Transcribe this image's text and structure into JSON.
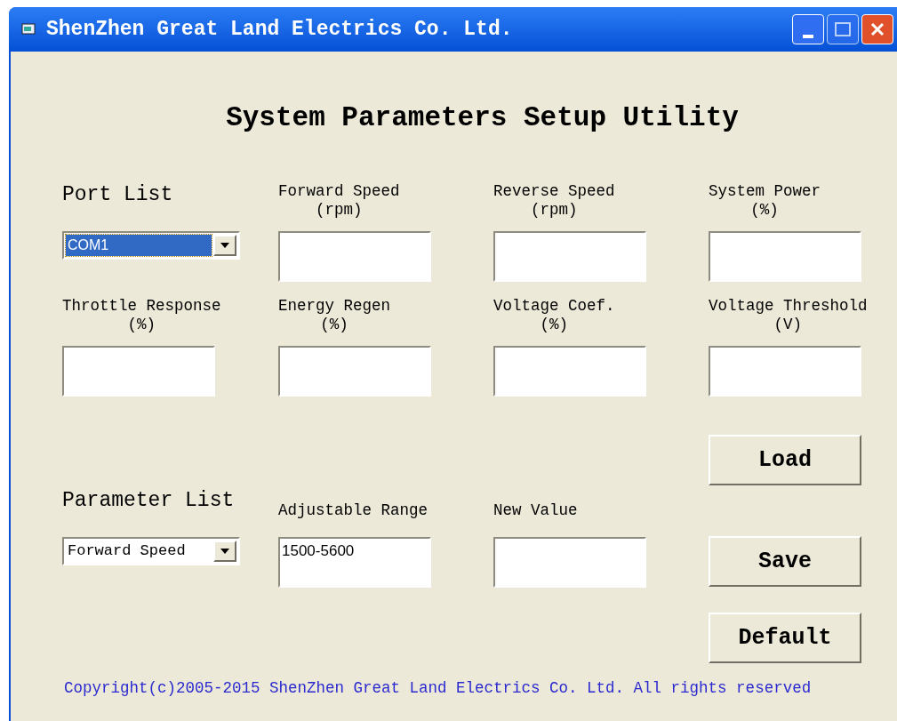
{
  "window": {
    "title": "ShenZhen Great Land Electrics Co. Ltd."
  },
  "heading": "System Parameters Setup Utility",
  "port_list": {
    "label": "Port List",
    "value": "COM1",
    "focused": true
  },
  "fields": [
    {
      "label": "Forward Speed",
      "unit": "(rpm)"
    },
    {
      "label": "Reverse Speed",
      "unit": "(rpm)"
    },
    {
      "label": "System Power",
      "unit": "(%)"
    },
    {
      "label": "Throttle Response",
      "unit": "(%)"
    },
    {
      "label": "Energy Regen",
      "unit": "(%)"
    },
    {
      "label": "Voltage Coef.",
      "unit": "(%)"
    },
    {
      "label": "Voltage Threshold",
      "unit": "(V)"
    }
  ],
  "parameter_list": {
    "label": "Parameter List",
    "value": "Forward Speed",
    "focused": false
  },
  "adjustable_range": {
    "label": "Adjustable Range",
    "value": "1500-5600"
  },
  "new_value": {
    "label": "New Value"
  },
  "buttons": [
    "Load",
    "Save",
    "Default"
  ],
  "copyright": "Copyright(c)2005-2015 ShenZhen Great Land Electrics Co. Ltd. All rights reserved"
}
